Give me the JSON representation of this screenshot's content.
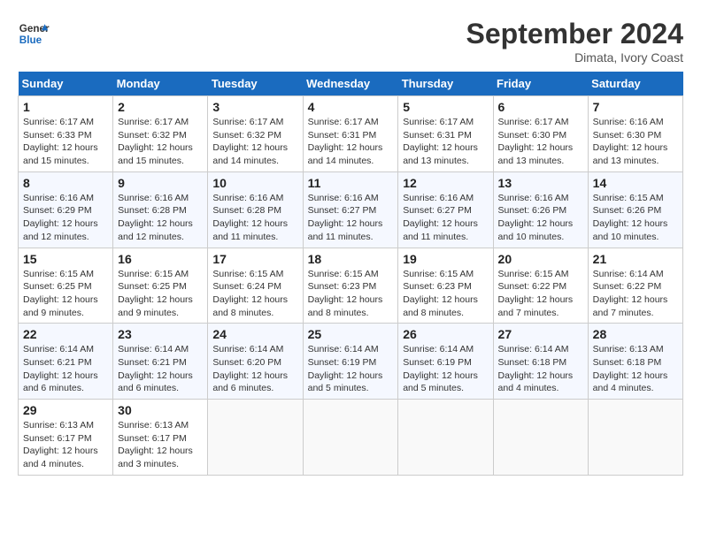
{
  "header": {
    "logo_line1": "General",
    "logo_line2": "Blue",
    "month": "September 2024",
    "location": "Dimata, Ivory Coast"
  },
  "days_of_week": [
    "Sunday",
    "Monday",
    "Tuesday",
    "Wednesday",
    "Thursday",
    "Friday",
    "Saturday"
  ],
  "weeks": [
    [
      {
        "day": 1,
        "sunrise": "6:17 AM",
        "sunset": "6:33 PM",
        "daylight": "12 hours and 15 minutes."
      },
      {
        "day": 2,
        "sunrise": "6:17 AM",
        "sunset": "6:32 PM",
        "daylight": "12 hours and 15 minutes."
      },
      {
        "day": 3,
        "sunrise": "6:17 AM",
        "sunset": "6:32 PM",
        "daylight": "12 hours and 14 minutes."
      },
      {
        "day": 4,
        "sunrise": "6:17 AM",
        "sunset": "6:31 PM",
        "daylight": "12 hours and 14 minutes."
      },
      {
        "day": 5,
        "sunrise": "6:17 AM",
        "sunset": "6:31 PM",
        "daylight": "12 hours and 13 minutes."
      },
      {
        "day": 6,
        "sunrise": "6:17 AM",
        "sunset": "6:30 PM",
        "daylight": "12 hours and 13 minutes."
      },
      {
        "day": 7,
        "sunrise": "6:16 AM",
        "sunset": "6:30 PM",
        "daylight": "12 hours and 13 minutes."
      }
    ],
    [
      {
        "day": 8,
        "sunrise": "6:16 AM",
        "sunset": "6:29 PM",
        "daylight": "12 hours and 12 minutes."
      },
      {
        "day": 9,
        "sunrise": "6:16 AM",
        "sunset": "6:28 PM",
        "daylight": "12 hours and 12 minutes."
      },
      {
        "day": 10,
        "sunrise": "6:16 AM",
        "sunset": "6:28 PM",
        "daylight": "12 hours and 11 minutes."
      },
      {
        "day": 11,
        "sunrise": "6:16 AM",
        "sunset": "6:27 PM",
        "daylight": "12 hours and 11 minutes."
      },
      {
        "day": 12,
        "sunrise": "6:16 AM",
        "sunset": "6:27 PM",
        "daylight": "12 hours and 11 minutes."
      },
      {
        "day": 13,
        "sunrise": "6:16 AM",
        "sunset": "6:26 PM",
        "daylight": "12 hours and 10 minutes."
      },
      {
        "day": 14,
        "sunrise": "6:15 AM",
        "sunset": "6:26 PM",
        "daylight": "12 hours and 10 minutes."
      }
    ],
    [
      {
        "day": 15,
        "sunrise": "6:15 AM",
        "sunset": "6:25 PM",
        "daylight": "12 hours and 9 minutes."
      },
      {
        "day": 16,
        "sunrise": "6:15 AM",
        "sunset": "6:25 PM",
        "daylight": "12 hours and 9 minutes."
      },
      {
        "day": 17,
        "sunrise": "6:15 AM",
        "sunset": "6:24 PM",
        "daylight": "12 hours and 8 minutes."
      },
      {
        "day": 18,
        "sunrise": "6:15 AM",
        "sunset": "6:23 PM",
        "daylight": "12 hours and 8 minutes."
      },
      {
        "day": 19,
        "sunrise": "6:15 AM",
        "sunset": "6:23 PM",
        "daylight": "12 hours and 8 minutes."
      },
      {
        "day": 20,
        "sunrise": "6:15 AM",
        "sunset": "6:22 PM",
        "daylight": "12 hours and 7 minutes."
      },
      {
        "day": 21,
        "sunrise": "6:14 AM",
        "sunset": "6:22 PM",
        "daylight": "12 hours and 7 minutes."
      }
    ],
    [
      {
        "day": 22,
        "sunrise": "6:14 AM",
        "sunset": "6:21 PM",
        "daylight": "12 hours and 6 minutes."
      },
      {
        "day": 23,
        "sunrise": "6:14 AM",
        "sunset": "6:21 PM",
        "daylight": "12 hours and 6 minutes."
      },
      {
        "day": 24,
        "sunrise": "6:14 AM",
        "sunset": "6:20 PM",
        "daylight": "12 hours and 6 minutes."
      },
      {
        "day": 25,
        "sunrise": "6:14 AM",
        "sunset": "6:19 PM",
        "daylight": "12 hours and 5 minutes."
      },
      {
        "day": 26,
        "sunrise": "6:14 AM",
        "sunset": "6:19 PM",
        "daylight": "12 hours and 5 minutes."
      },
      {
        "day": 27,
        "sunrise": "6:14 AM",
        "sunset": "6:18 PM",
        "daylight": "12 hours and 4 minutes."
      },
      {
        "day": 28,
        "sunrise": "6:13 AM",
        "sunset": "6:18 PM",
        "daylight": "12 hours and 4 minutes."
      }
    ],
    [
      {
        "day": 29,
        "sunrise": "6:13 AM",
        "sunset": "6:17 PM",
        "daylight": "12 hours and 4 minutes."
      },
      {
        "day": 30,
        "sunrise": "6:13 AM",
        "sunset": "6:17 PM",
        "daylight": "12 hours and 3 minutes."
      },
      null,
      null,
      null,
      null,
      null
    ]
  ]
}
